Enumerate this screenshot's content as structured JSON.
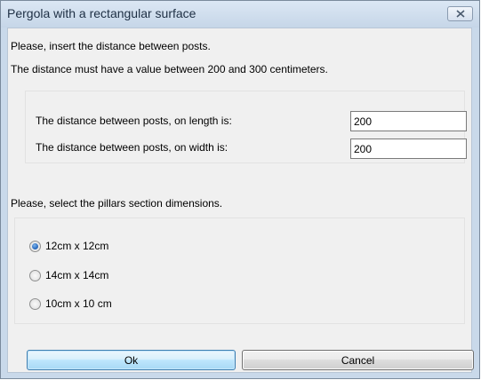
{
  "window": {
    "title": "Pergola with a rectangular surface"
  },
  "intro": {
    "line1": "Please, insert the distance between posts.",
    "line2": "The distance must have a value between 200 and 300 centimeters."
  },
  "distances": {
    "length_label": "The distance between posts, on length is:",
    "length_value": "200",
    "width_label": "The distance between posts, on width is:",
    "width_value": "200"
  },
  "pillars": {
    "prompt": "Please, select the pillars section dimensions.",
    "options": [
      {
        "label": "12cm x 12cm",
        "selected": true
      },
      {
        "label": "14cm x 14cm",
        "selected": false
      },
      {
        "label": "10cm x 10 cm",
        "selected": false
      }
    ]
  },
  "buttons": {
    "ok_label": "Ok",
    "cancel_label": "Cancel"
  },
  "icons": {
    "close": "close-icon"
  },
  "colors": {
    "title_bar": "#c9d9ea",
    "client_bg": "#f0f0f0",
    "radio_selected": "#2a6bc0"
  }
}
